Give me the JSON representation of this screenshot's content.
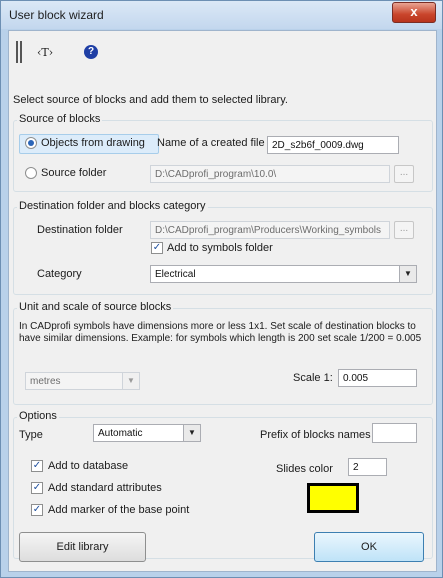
{
  "window": {
    "title": "User block wizard",
    "close_glyph": "x"
  },
  "toolbar": {
    "tool1_icon": "vertical-bars-icon",
    "tool2_label": "‹T›",
    "help_icon": "help-icon"
  },
  "intro_text": "Select source of blocks and add them to selected library.",
  "source": {
    "legend": "Source of blocks",
    "objects_label": "Objects from drawing",
    "objects_selected": true,
    "created_file_label": "Name of a created file",
    "created_file_value": "2D_s2b6f_0009.dwg",
    "folder_label": "Source folder",
    "folder_value": "D:\\CADprofi_program\\10.0\\",
    "browse_label": "..."
  },
  "destination": {
    "legend": "Destination folder and blocks category",
    "folder_label": "Destination folder",
    "folder_value": "D:\\CADprofi_program\\Producers\\Working_symbols",
    "browse_label": "...",
    "add_symbols_label": "Add to symbols folder",
    "add_symbols_checked": true,
    "category_label": "Category",
    "category_value": "Electrical"
  },
  "unit": {
    "legend": "Unit and scale of source blocks",
    "description": "In CADprofi symbols have dimensions more or less 1x1. Set scale of destination blocks to have similar dimensions. Example: for symbols which length is 200 set scale 1/200 = 0.005",
    "unit_value": "metres",
    "scale_label": "Scale  1:",
    "scale_value": "0.005"
  },
  "options": {
    "legend": "Options",
    "type_label": "Type",
    "type_value": "Automatic",
    "prefix_label": "Prefix of blocks names",
    "prefix_value": "",
    "add_db_label": "Add to database",
    "add_attr_label": "Add standard attributes",
    "add_marker_label": "Add marker of the base point",
    "slides_label": "Slides color",
    "slides_value": "2",
    "slide_color": "#ffff00"
  },
  "buttons": {
    "edit_library": "Edit library",
    "ok": "OK"
  }
}
